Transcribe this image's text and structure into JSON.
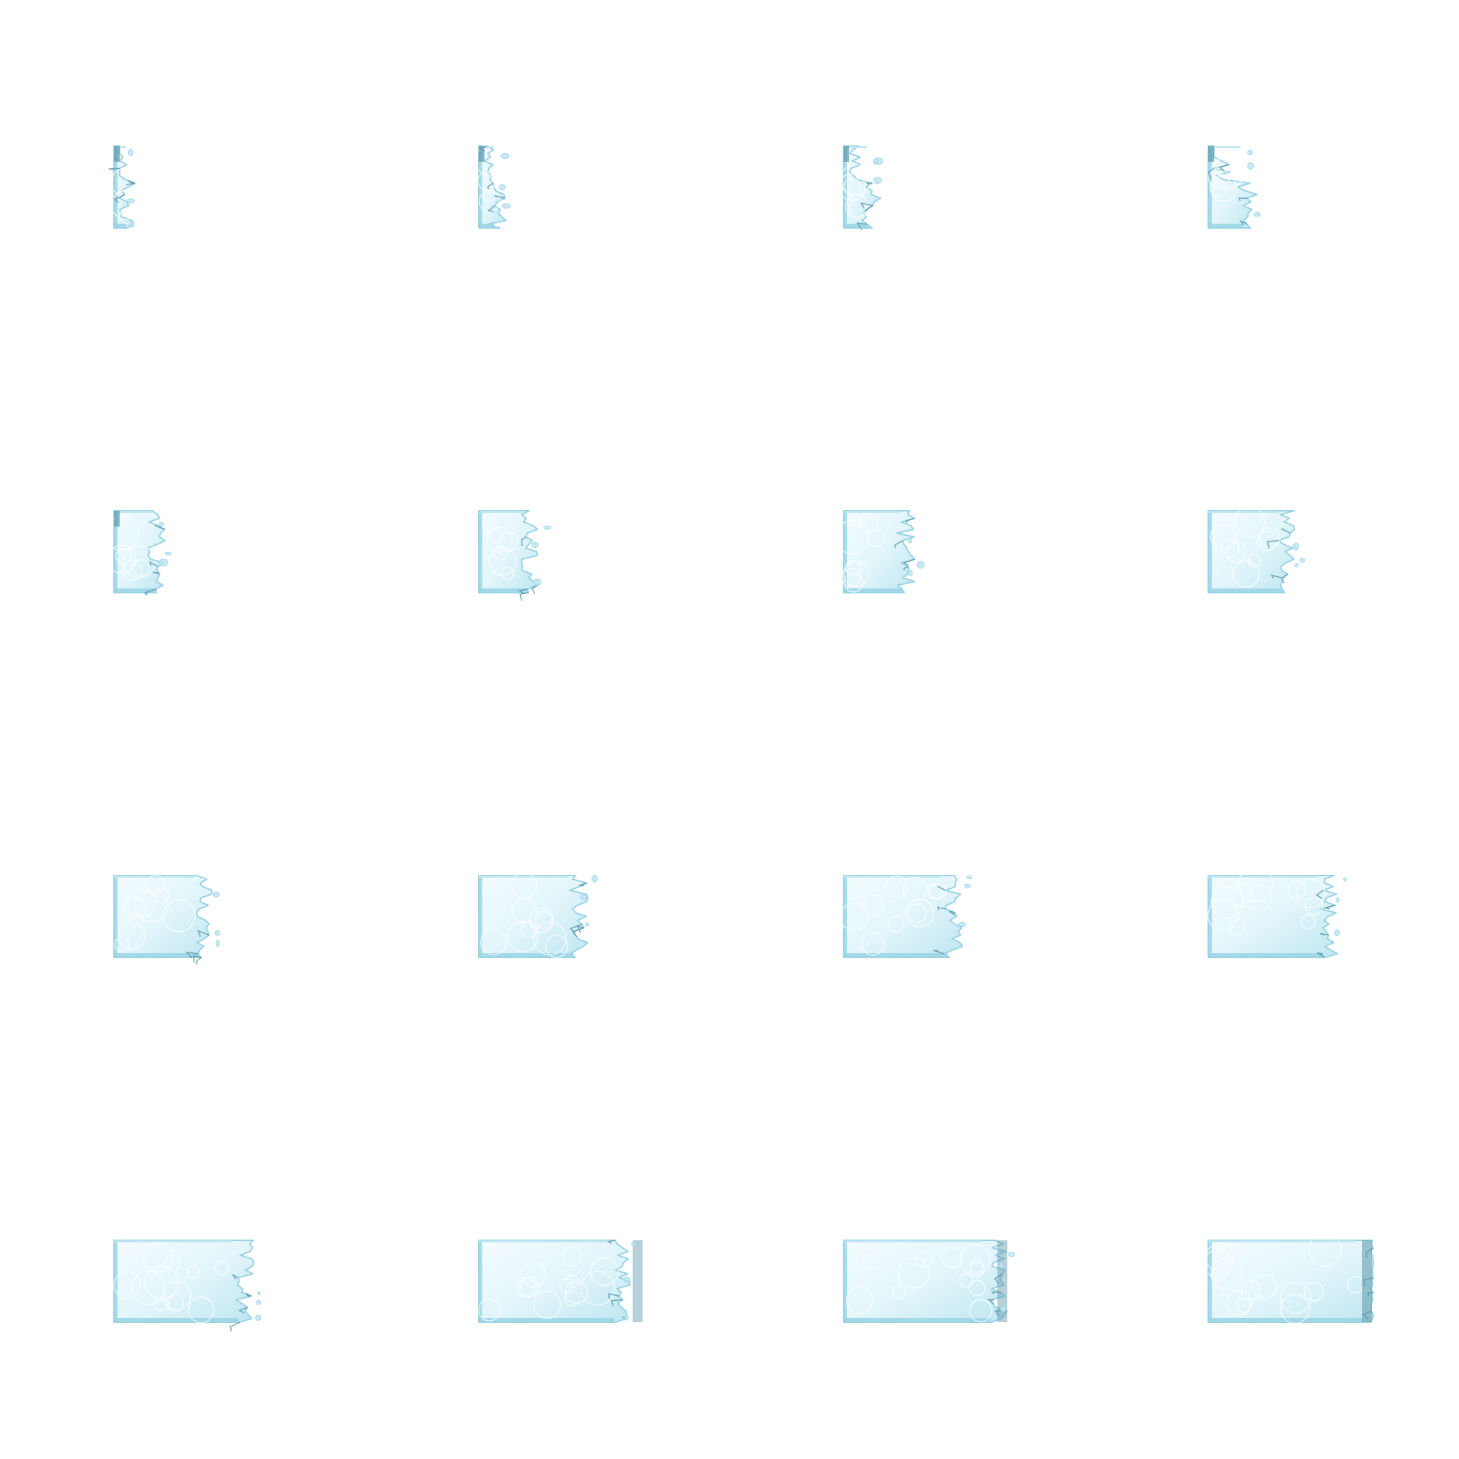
{
  "sprite_sheet": {
    "grid": {
      "columns": 4,
      "rows": 4
    },
    "fill_order": "row-major",
    "palette": {
      "background": "#ffffff",
      "ice_fill": "#e3f6fb",
      "ice_light": "#f4fcfe",
      "ice_mid": "#bfe6f1",
      "ice_edge": "#9ad3e4",
      "ice_dark": "#5d97ab",
      "ice_deep": "#3f7486"
    },
    "frames": [
      {
        "index": 1,
        "fill_progress": 0.04
      },
      {
        "index": 2,
        "fill_progress": 0.1
      },
      {
        "index": 3,
        "fill_progress": 0.16
      },
      {
        "index": 4,
        "fill_progress": 0.22
      },
      {
        "index": 5,
        "fill_progress": 0.26
      },
      {
        "index": 6,
        "fill_progress": 0.31
      },
      {
        "index": 7,
        "fill_progress": 0.38
      },
      {
        "index": 8,
        "fill_progress": 0.48
      },
      {
        "index": 9,
        "fill_progress": 0.55
      },
      {
        "index": 10,
        "fill_progress": 0.61
      },
      {
        "index": 11,
        "fill_progress": 0.67
      },
      {
        "index": 12,
        "fill_progress": 0.74
      },
      {
        "index": 13,
        "fill_progress": 0.8
      },
      {
        "index": 14,
        "fill_progress": 0.87
      },
      {
        "index": 15,
        "fill_progress": 0.94
      },
      {
        "index": 16,
        "fill_progress": 1.0
      }
    ]
  }
}
